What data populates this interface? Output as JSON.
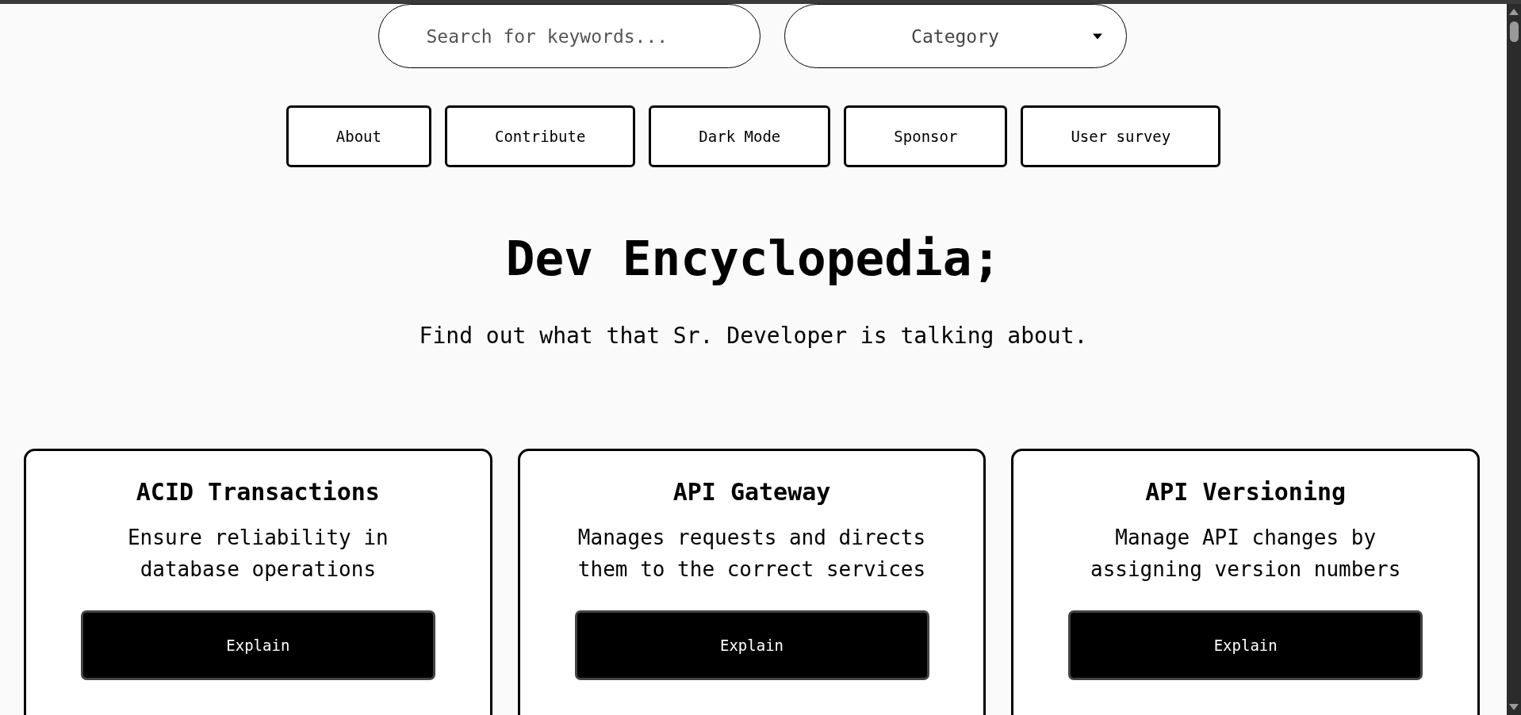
{
  "search": {
    "placeholder": "Search for keywords..."
  },
  "category": {
    "value": "Category"
  },
  "nav_buttons": [
    "About",
    "Contribute",
    "Dark Mode",
    "Sponsor",
    "User survey"
  ],
  "title": "Dev Encyclopedia;",
  "subtitle": "Find out what that Sr. Developer is talking about.",
  "cards": [
    {
      "title": "ACID Transactions",
      "description": "Ensure reliability in database operations",
      "button": "Explain"
    },
    {
      "title": "API Gateway",
      "description": "Manages requests and directs them to the correct services",
      "button": "Explain"
    },
    {
      "title": "API Versioning",
      "description": "Manage API changes by assigning version numbers",
      "button": "Explain"
    }
  ]
}
